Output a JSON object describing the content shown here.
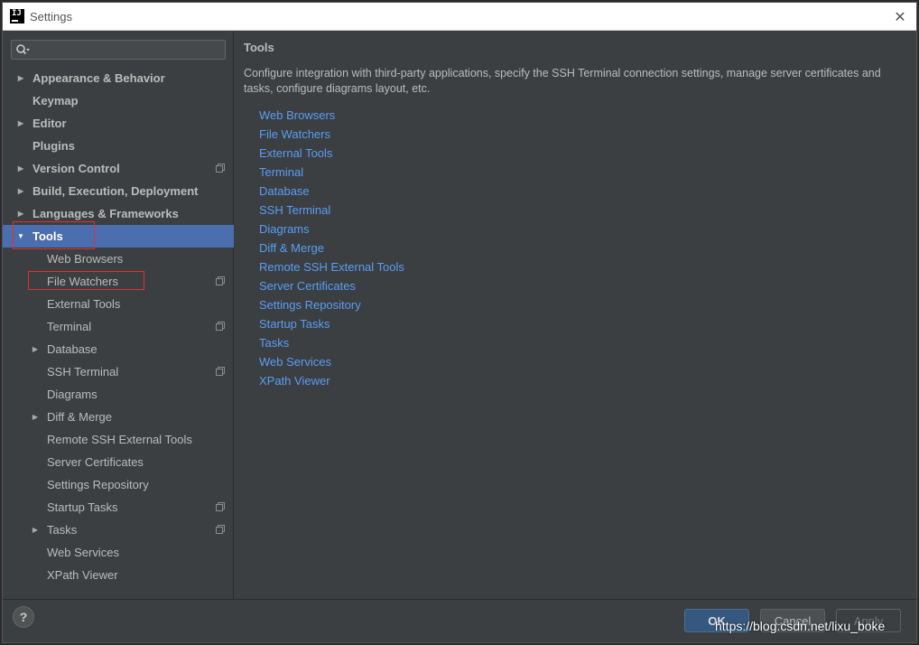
{
  "window": {
    "title": "Settings",
    "app_icon": "intellij-icon",
    "close_glyph": "✕"
  },
  "sidebar": {
    "search_placeholder": "",
    "items": [
      {
        "label": "Appearance & Behavior",
        "bold": true,
        "arrow": "right",
        "indent": 0,
        "proj_icon": false
      },
      {
        "label": "Keymap",
        "bold": true,
        "arrow": "none",
        "indent": 0,
        "proj_icon": false
      },
      {
        "label": "Editor",
        "bold": true,
        "arrow": "right",
        "indent": 0,
        "proj_icon": false
      },
      {
        "label": "Plugins",
        "bold": true,
        "arrow": "none",
        "indent": 0,
        "proj_icon": false
      },
      {
        "label": "Version Control",
        "bold": true,
        "arrow": "right",
        "indent": 0,
        "proj_icon": true
      },
      {
        "label": "Build, Execution, Deployment",
        "bold": true,
        "arrow": "right",
        "indent": 0,
        "proj_icon": false
      },
      {
        "label": "Languages & Frameworks",
        "bold": true,
        "arrow": "right",
        "indent": 0,
        "proj_icon": false
      },
      {
        "label": "Tools",
        "bold": true,
        "arrow": "down",
        "indent": 0,
        "proj_icon": false,
        "selected": true
      },
      {
        "label": "Web Browsers",
        "bold": false,
        "arrow": "none",
        "indent": 1,
        "proj_icon": false
      },
      {
        "label": "File Watchers",
        "bold": false,
        "arrow": "none",
        "indent": 1,
        "proj_icon": true
      },
      {
        "label": "External Tools",
        "bold": false,
        "arrow": "none",
        "indent": 1,
        "proj_icon": false
      },
      {
        "label": "Terminal",
        "bold": false,
        "arrow": "none",
        "indent": 1,
        "proj_icon": true
      },
      {
        "label": "Database",
        "bold": false,
        "arrow": "right",
        "indent": 1,
        "proj_icon": false
      },
      {
        "label": "SSH Terminal",
        "bold": false,
        "arrow": "none",
        "indent": 1,
        "proj_icon": true
      },
      {
        "label": "Diagrams",
        "bold": false,
        "arrow": "none",
        "indent": 1,
        "proj_icon": false
      },
      {
        "label": "Diff & Merge",
        "bold": false,
        "arrow": "right",
        "indent": 1,
        "proj_icon": false
      },
      {
        "label": "Remote SSH External Tools",
        "bold": false,
        "arrow": "none",
        "indent": 1,
        "proj_icon": false
      },
      {
        "label": "Server Certificates",
        "bold": false,
        "arrow": "none",
        "indent": 1,
        "proj_icon": false
      },
      {
        "label": "Settings Repository",
        "bold": false,
        "arrow": "none",
        "indent": 1,
        "proj_icon": false
      },
      {
        "label": "Startup Tasks",
        "bold": false,
        "arrow": "none",
        "indent": 1,
        "proj_icon": true
      },
      {
        "label": "Tasks",
        "bold": false,
        "arrow": "right",
        "indent": 1,
        "proj_icon": true
      },
      {
        "label": "Web Services",
        "bold": false,
        "arrow": "none",
        "indent": 1,
        "proj_icon": false
      },
      {
        "label": "XPath Viewer",
        "bold": false,
        "arrow": "none",
        "indent": 1,
        "proj_icon": false
      }
    ]
  },
  "content": {
    "title": "Tools",
    "description": "Configure integration with third-party applications, specify the SSH Terminal connection settings, manage server certificates and tasks, configure diagrams layout, etc.",
    "links": [
      "Web Browsers",
      "File Watchers",
      "External Tools",
      "Terminal",
      "Database",
      "SSH Terminal",
      "Diagrams",
      "Diff & Merge",
      "Remote SSH External Tools",
      "Server Certificates",
      "Settings Repository",
      "Startup Tasks",
      "Tasks",
      "Web Services",
      "XPath Viewer"
    ]
  },
  "footer": {
    "help_label": "?",
    "ok_label": "OK",
    "cancel_label": "Cancel",
    "apply_label": "Apply",
    "watermark": "https://blog.csdn.net/lixu_boke"
  },
  "colors": {
    "background": "#3c3f41",
    "selection": "#4b6eaf",
    "link": "#589df6",
    "text": "#bbbbbb",
    "highlight_box": "#e03131"
  }
}
